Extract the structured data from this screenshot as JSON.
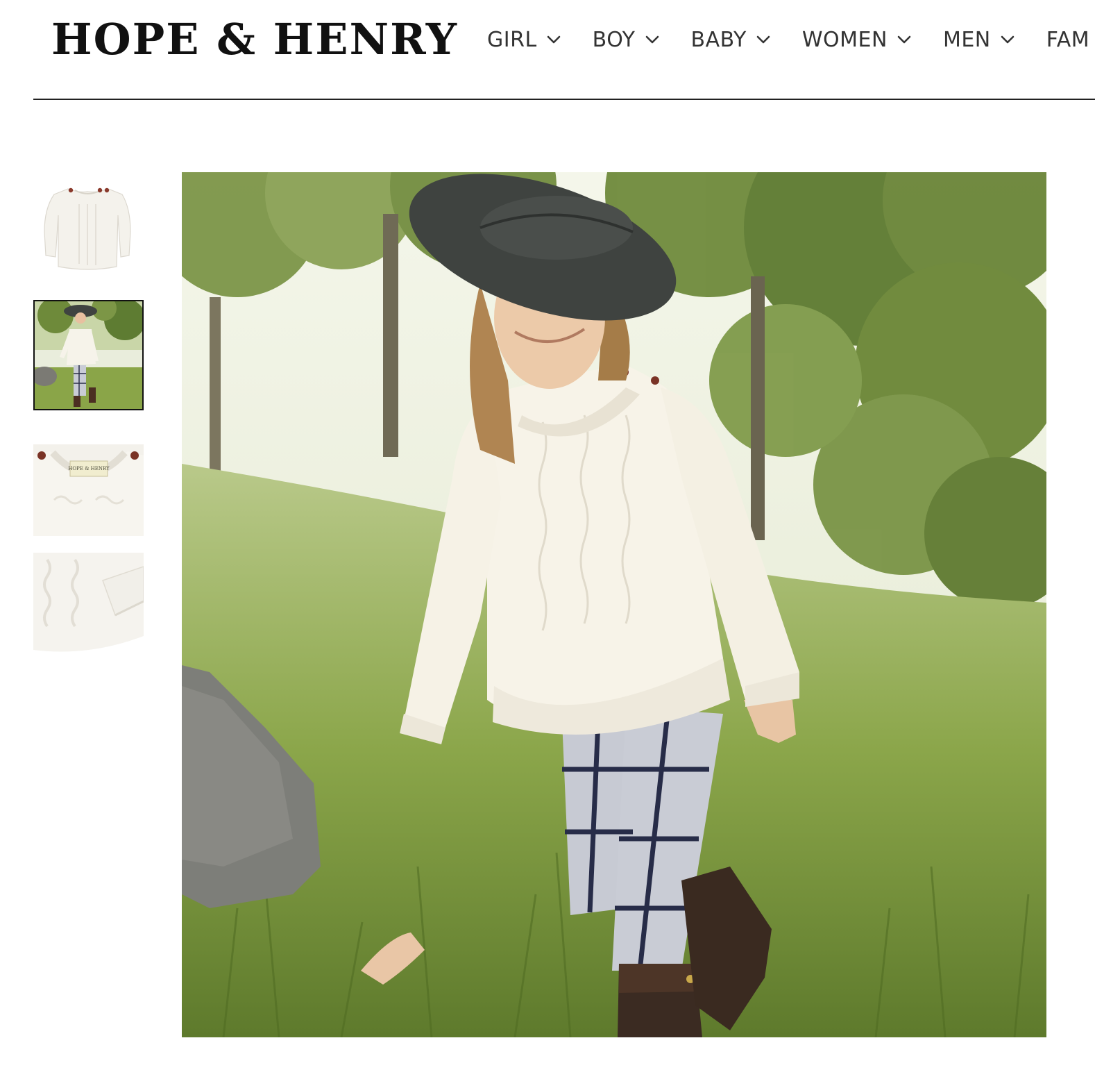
{
  "brand": {
    "logo_text": "HOPE & HENRY"
  },
  "nav": {
    "items": [
      {
        "label": "GIRL",
        "icon": "chevron-down-icon"
      },
      {
        "label": "BOY",
        "icon": "chevron-down-icon"
      },
      {
        "label": "BABY",
        "icon": "chevron-down-icon"
      },
      {
        "label": "WOMEN",
        "icon": "chevron-down-icon"
      },
      {
        "label": "MEN",
        "icon": "chevron-down-icon"
      },
      {
        "label": "FAM",
        "icon": "chevron-down-icon"
      }
    ]
  },
  "gallery": {
    "thumbnails": [
      {
        "subject": "sweater flat lay",
        "selected": false
      },
      {
        "subject": "model in sweater outdoors",
        "selected": true
      },
      {
        "subject": "collar and label detail",
        "selected": false
      },
      {
        "subject": "cable knit and cuff detail",
        "selected": false
      }
    ],
    "label_text": "HOPE & HENRY",
    "main_image_subject": "girl in cream cable knit sweater, wide-brim hat, windowpane leggings and boots walking in a grassy field"
  },
  "colors": {
    "text": "#222222",
    "divider": "#222222",
    "sweater": "#f6f2e8",
    "grass": "#7f9a3f",
    "hat": "#3f4340",
    "button": "#7a3326"
  }
}
